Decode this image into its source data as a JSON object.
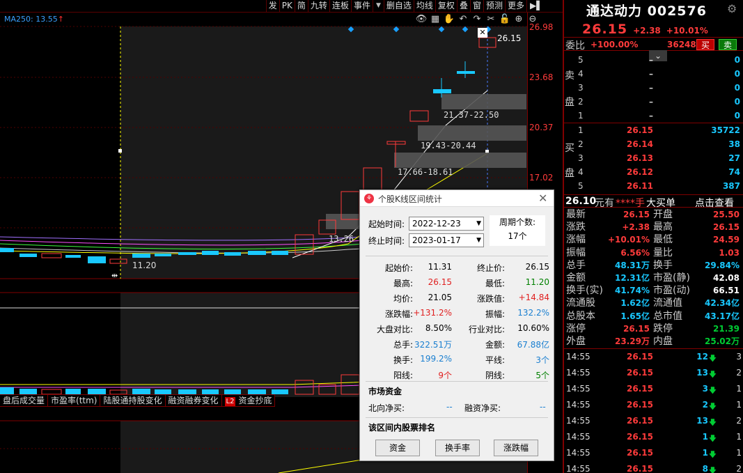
{
  "toolbar": {
    "buttons": [
      "发",
      "PK",
      "简",
      "九转",
      "连板",
      "事件",
      "▼",
      "删自选",
      "均线",
      "复权",
      "叠",
      "窗",
      "预测",
      "更多",
      "▶▌"
    ]
  },
  "chart": {
    "ma_label": "MA250: 13.55",
    "ma_arrow": "↑",
    "price_ticks": [
      "26.98",
      "23.68",
      "20.37",
      "17.02"
    ],
    "cross_price": "26.15",
    "cross_marker": "✕",
    "low_label": "11.20",
    "range_labels": [
      "21.37-22.50",
      "19.43-20.44",
      "17.66-18.61",
      "13.26"
    ],
    "indicator_tabs": [
      "盘后成交量",
      "市盈率(ttm)",
      "陆股通持股变化",
      "融资融券变化",
      "资金抄底"
    ],
    "l2_badge": "L2",
    "colors": {
      "up": "#ff3b3b",
      "down": "#19c8ff",
      "axis": "#800000"
    }
  },
  "quote": {
    "name": "通达动力",
    "code": "002576",
    "price": "26.15",
    "change": "+2.38",
    "pct": "+10.01%",
    "weibi_label": "委比",
    "weibi": "+100.00%",
    "weicha": "36248",
    "buy_label": "买",
    "sell_label": "卖",
    "sell_side": [
      "卖",
      "盘"
    ],
    "buy_side": [
      "买",
      "盘"
    ],
    "asks": [
      {
        "level": "5",
        "price": "–",
        "vol": "0"
      },
      {
        "level": "4",
        "price": "–",
        "vol": "0"
      },
      {
        "level": "3",
        "price": "–",
        "vol": "0"
      },
      {
        "level": "2",
        "price": "–",
        "vol": "0"
      },
      {
        "level": "1",
        "price": "–",
        "vol": "0"
      }
    ],
    "bids": [
      {
        "level": "1",
        "price": "26.15",
        "vol": "35722"
      },
      {
        "level": "2",
        "price": "26.14",
        "vol": "38"
      },
      {
        "level": "3",
        "price": "26.13",
        "vol": "27"
      },
      {
        "level": "4",
        "price": "26.12",
        "vol": "74"
      },
      {
        "level": "5",
        "price": "26.11",
        "vol": "387"
      }
    ],
    "info_head": {
      "price": "26.10",
      "unit": "元有",
      "stars": "****手",
      "big": "大买单",
      "view": "点击查看"
    },
    "stats": [
      {
        "k1": "最新",
        "v1": "26.15",
        "c1": "#ff3b3b",
        "k2": "开盘",
        "v2": "25.50",
        "c2": "#ff3b3b"
      },
      {
        "k1": "涨跌",
        "v1": "+2.38",
        "c1": "#ff3b3b",
        "k2": "最高",
        "v2": "26.15",
        "c2": "#ff3b3b"
      },
      {
        "k1": "涨幅",
        "v1": "+10.01%",
        "c1": "#ff3b3b",
        "k2": "最低",
        "v2": "24.59",
        "c2": "#ff3b3b"
      },
      {
        "k1": "振幅",
        "v1": "6.56%",
        "c1": "#ff3b3b",
        "k2": "量比",
        "v2": "1.03",
        "c2": "#ff3b3b"
      },
      {
        "k1": "总手",
        "v1": "48.31万",
        "c1": "#19c8ff",
        "k2": "换手",
        "v2": "29.84%",
        "c2": "#19c8ff"
      },
      {
        "k1": "金额",
        "v1": "12.31亿",
        "c1": "#19c8ff",
        "k2": "市盈(静)",
        "v2": "42.08",
        "c2": "#ffffff"
      },
      {
        "k1": "换手(实)",
        "v1": "41.74%",
        "c1": "#19c8ff",
        "k2": "市盈(动)",
        "v2": "66.51",
        "c2": "#ffffff"
      },
      {
        "k1": "流通股",
        "v1": "1.62亿",
        "c1": "#19c8ff",
        "k2": "流通值",
        "v2": "42.34亿",
        "c2": "#19c8ff"
      },
      {
        "k1": "总股本",
        "v1": "1.65亿",
        "c1": "#19c8ff",
        "k2": "总市值",
        "v2": "43.17亿",
        "c2": "#19c8ff"
      },
      {
        "k1": "涨停",
        "v1": "26.15",
        "c1": "#ff3b3b",
        "k2": "跌停",
        "v2": "21.39",
        "c2": "#0c3"
      },
      {
        "k1": "外盘",
        "v1": "23.29万",
        "c1": "#ff3b3b",
        "k2": "内盘",
        "v2": "25.02万",
        "c2": "#0c3"
      }
    ],
    "ticks": [
      {
        "t": "14:55",
        "p": "26.15",
        "v": "12",
        "n": "3"
      },
      {
        "t": "14:55",
        "p": "26.15",
        "v": "13",
        "n": "2"
      },
      {
        "t": "14:55",
        "p": "26.15",
        "v": "3",
        "n": "1"
      },
      {
        "t": "14:55",
        "p": "26.15",
        "v": "2",
        "n": "1"
      },
      {
        "t": "14:55",
        "p": "26.15",
        "v": "13",
        "n": "2"
      },
      {
        "t": "14:55",
        "p": "26.15",
        "v": "1",
        "n": "1"
      },
      {
        "t": "14:55",
        "p": "26.15",
        "v": "1",
        "n": "1"
      },
      {
        "t": "14:55",
        "p": "26.15",
        "v": "8",
        "n": "2"
      }
    ]
  },
  "dialog": {
    "title": "个股K线区间统计",
    "start_label": "起始时间:",
    "start_value": "2022-12-23",
    "end_label": "终止时间:",
    "end_value": "2023-01-17",
    "period_label": "周期个数:",
    "period_value": "17个",
    "stats": [
      {
        "k": "起始价:",
        "v": "11.31",
        "vc": "#000",
        "k2": "终止价:",
        "v2": "26.15",
        "vc2": "#000"
      },
      {
        "k": "最高:",
        "v": "26.15",
        "vc": "#e02020",
        "k2": "最低:",
        "v2": "11.20",
        "vc2": "#008000"
      },
      {
        "k": "均价:",
        "v": "21.05",
        "vc": "#000",
        "k2": "涨跌值:",
        "v2": "+14.84",
        "vc2": "#e02020"
      },
      {
        "k": "涨跌幅:",
        "v": "+131.2%",
        "vc": "#e02020",
        "k2": "振幅:",
        "v2": "132.2%",
        "vc2": "#1a7fd0"
      },
      {
        "k": "大盘对比:",
        "v": "8.50%",
        "vc": "#000",
        "k2": "行业对比:",
        "v2": "10.60%",
        "vc2": "#000"
      },
      {
        "k": "总手:",
        "v": "322.51万",
        "vc": "#1a7fd0",
        "k2": "金额:",
        "v2": "67.88亿",
        "vc2": "#1a7fd0"
      },
      {
        "k": "换手:",
        "v": "199.2%",
        "vc": "#1a7fd0",
        "k2": "平线:",
        "v2": "3个",
        "vc2": "#1a7fd0"
      },
      {
        "k": "阳线:",
        "v": "9个",
        "vc": "#e02020",
        "k2": "阴线:",
        "v2": "5个",
        "vc2": "#008000"
      }
    ],
    "fund_head": "市场资金",
    "north_label": "北向净买:",
    "north_value": "--",
    "margin_label": "融资净买:",
    "margin_value": "--",
    "rank_head": "该区间内股票排名",
    "rank_buttons": [
      "资金",
      "换手率",
      "涨跌幅"
    ]
  }
}
